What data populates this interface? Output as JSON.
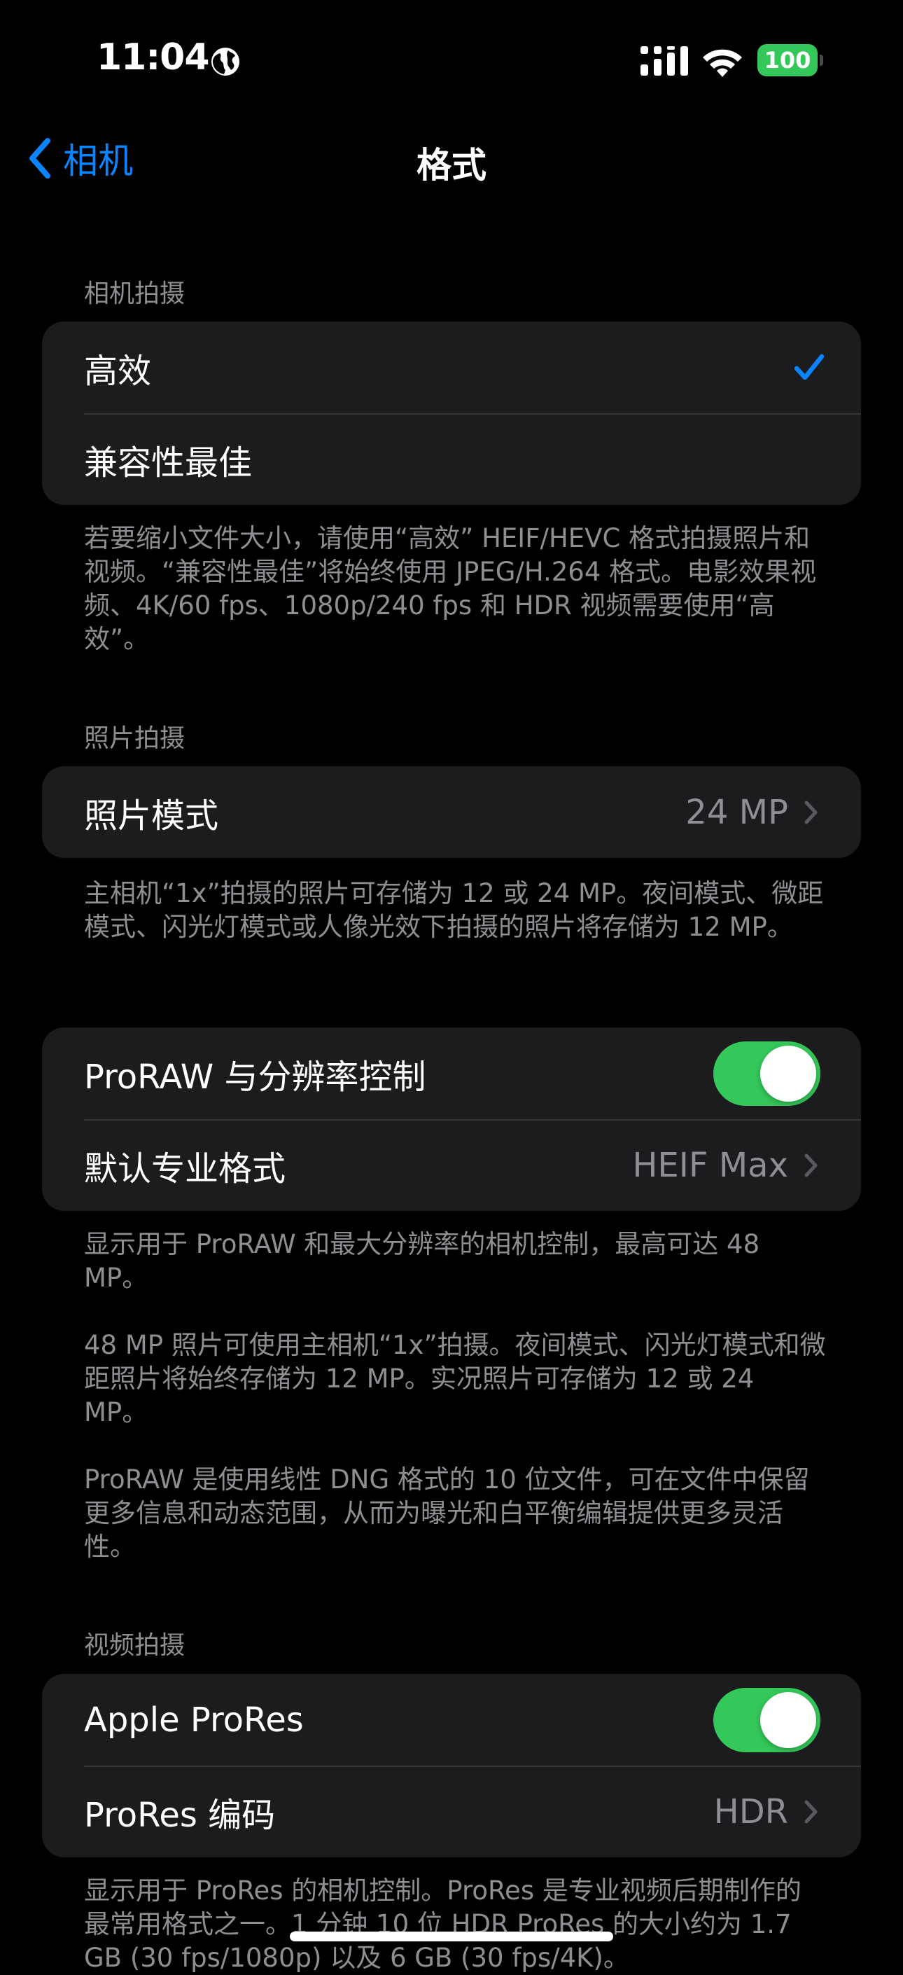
{
  "status_bar": {
    "time": "11:04",
    "battery": "100",
    "icons": [
      "globe-icon",
      "cellular-signal-icon",
      "wifi-icon",
      "battery-icon"
    ]
  },
  "nav": {
    "back_label": "相机",
    "title": "格式"
  },
  "camera_capture": {
    "header": "相机拍摄",
    "options": [
      {
        "label": "高效",
        "selected": true
      },
      {
        "label": "兼容性最佳",
        "selected": false
      }
    ],
    "footer": "若要缩小文件大小，请使用“高效” HEIF/HEVC 格式拍摄照片和视频。“兼容性最佳”将始终使用 JPEG/H.264 格式。电影效果视频、4K/60 fps、1080p/240 fps 和 HDR 视频需要使用“高效”。"
  },
  "photo_capture": {
    "header": "照片拍摄",
    "photo_mode_label": "照片模式",
    "photo_mode_value": "24 MP",
    "footer": "主相机“1x”拍摄的照片可存储为 12 或 24 MP。夜间模式、微距模式、闪光灯模式或人像光效下拍摄的照片将存储为 12 MP。"
  },
  "proraw": {
    "toggle_label": "ProRAW 与分辨率控制",
    "toggle_on": true,
    "default_format_label": "默认专业格式",
    "default_format_value": "HEIF Max",
    "footer_1": "显示用于 ProRAW 和最大分辨率的相机控制，最高可达 48 MP。",
    "footer_2": "48 MP 照片可使用主相机“1x”拍摄。夜间模式、闪光灯模式和微距照片将始终存储为 12 MP。实况照片可存储为 12 或 24 MP。",
    "footer_3": "ProRAW 是使用线性 DNG 格式的 10 位文件，可在文件中保留更多信息和动态范围，从而为曝光和白平衡编辑提供更多灵活性。"
  },
  "video_capture": {
    "header": "视频拍摄",
    "prores_label": "Apple ProRes",
    "prores_on": true,
    "encoding_label": "ProRes 编码",
    "encoding_value": "HDR",
    "footer": "显示用于 ProRes 的相机控制。ProRes 是专业视频后期制作的最常用格式之一。1 分钟 10 位 HDR ProRes 的大小约为 1.7 GB (30 fps/1080p) 以及 6 GB (30 fps/4K)。"
  },
  "colors": {
    "accent": "#0a84ff",
    "toggle_on": "#34c759",
    "background": "#000000",
    "group_background": "#1c1c1e",
    "secondary_text": "#8e8e93"
  }
}
